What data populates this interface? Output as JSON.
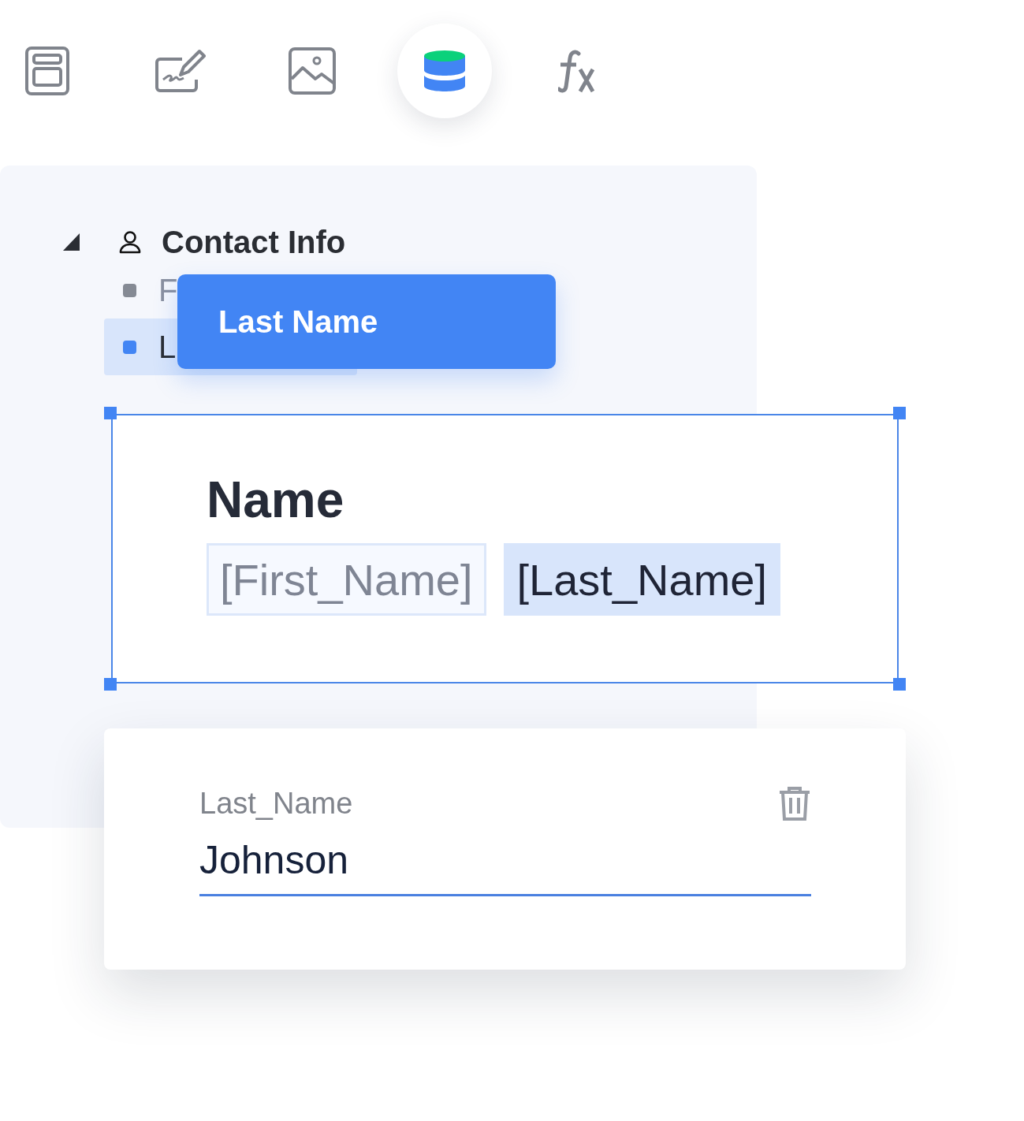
{
  "toolbar": [
    {
      "kind": "layout",
      "selected": false
    },
    {
      "kind": "signature",
      "selected": false
    },
    {
      "kind": "image",
      "selected": false
    },
    {
      "kind": "database",
      "selected": true
    },
    {
      "kind": "formula",
      "selected": false
    }
  ],
  "tree": {
    "label": "Contact Info",
    "expanded": true,
    "children": [
      {
        "label": "F",
        "selected": false
      },
      {
        "label": "L",
        "selected": true
      }
    ]
  },
  "drag_label": "Last Name",
  "text_block": {
    "title": "Name",
    "fields": [
      {
        "label": "[First_Name]",
        "selected": false
      },
      {
        "label": "[Last_Name]",
        "selected": true
      }
    ]
  },
  "editor": {
    "label": "Last_Name",
    "value": "Johnson"
  }
}
